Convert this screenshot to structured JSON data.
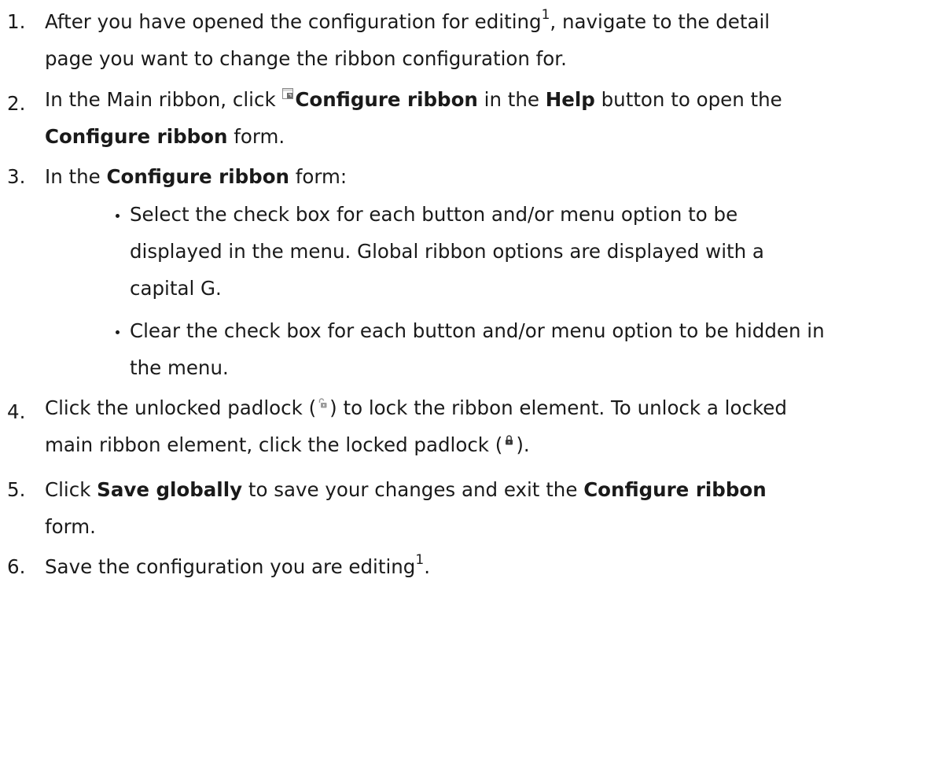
{
  "steps": [
    {
      "number": "1.",
      "line1_pre": "After you have opened the configuration for editing",
      "line1_sup": "1",
      "line1_post": ", navigate to the detail",
      "line2": "page you want to change the ribbon configuration for."
    },
    {
      "number": "2.",
      "line1_pre": "In the Main ribbon, click ",
      "line1_bold1": "Configure ribbon",
      "line1_mid": " in the ",
      "line1_bold2": "Help",
      "line1_post": " button to open the",
      "line2_bold": "Configure ribbon",
      "line2_post": " form."
    },
    {
      "number": "3.",
      "line1_pre": "In the ",
      "line1_bold": "Configure ribbon",
      "line1_post": " form:",
      "bullets": [
        {
          "line1": "Select the check box for each button and/or menu option to be",
          "line2": "displayed in the menu. Global ribbon options are displayed with a",
          "line3": "capital G."
        },
        {
          "line1": "Clear the check box for each button and/or menu option to be hidden in",
          "line2": "the menu."
        }
      ]
    },
    {
      "number": "4.",
      "line1_pre": "Click the unlocked padlock (",
      "line1_post": ") to lock the ribbon element. To unlock a locked",
      "line2_pre": "main ribbon element, click the locked padlock (",
      "line2_post": ")."
    },
    {
      "number": "5.",
      "line1_pre": "Click ",
      "line1_bold1": "Save globally",
      "line1_mid": " to save your changes and exit the ",
      "line1_bold2": "Configure ribbon",
      "line2": "form."
    },
    {
      "number": "6.",
      "line1_pre": "Save the configuration you are editing",
      "line1_sup": "1",
      "line1_post": "."
    }
  ],
  "icons": {
    "configure_ribbon": "configure-ribbon-icon",
    "unlocked_padlock": "unlocked-padlock-icon",
    "locked_padlock": "locked-padlock-icon"
  },
  "colors": {
    "text": "#1a1a1a",
    "icon_gray": "#8a8a8a",
    "icon_dark": "#4a4a4a",
    "icon_accent": "#d9d9d9"
  }
}
